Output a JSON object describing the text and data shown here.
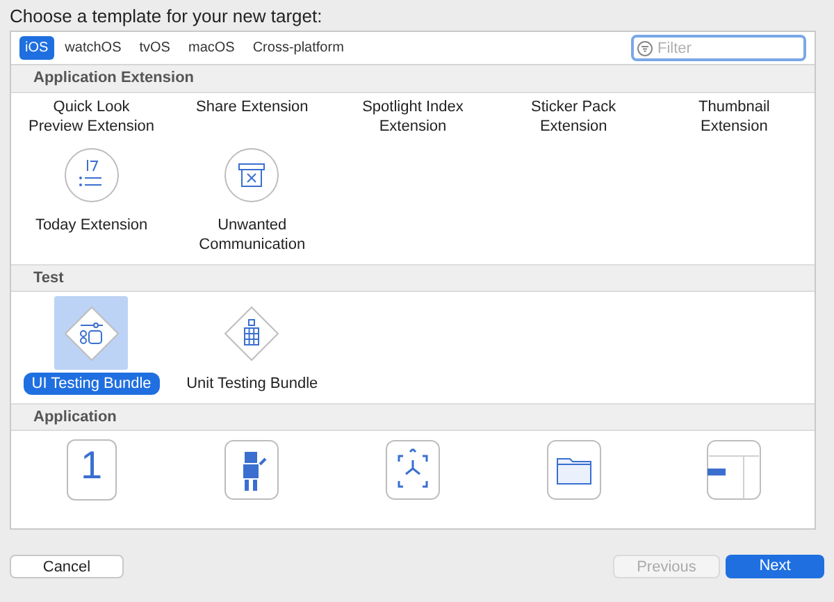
{
  "prompt": "Choose a template for your new target:",
  "tabs": [
    {
      "label": "iOS",
      "selected": true
    },
    {
      "label": "watchOS",
      "selected": false
    },
    {
      "label": "tvOS",
      "selected": false
    },
    {
      "label": "macOS",
      "selected": false
    },
    {
      "label": "Cross-platform",
      "selected": false
    }
  ],
  "filter": {
    "placeholder": "Filter"
  },
  "sections": [
    {
      "title": "Application Extension",
      "items": [
        {
          "label": "Quick Look Preview Extension",
          "selected": false
        },
        {
          "label": "Share Extension",
          "selected": false
        },
        {
          "label": "Spotlight Index Extension",
          "selected": false
        },
        {
          "label": "Sticker Pack Extension",
          "selected": false
        },
        {
          "label": "Thumbnail Extension",
          "selected": false
        },
        {
          "kind": "today",
          "label": "Today Extension",
          "selected": false
        },
        {
          "kind": "unwanted",
          "label": "Unwanted Communication",
          "selected": false
        }
      ]
    },
    {
      "title": "Test",
      "items": [
        {
          "kind": "ui-test",
          "label": "UI Testing Bundle",
          "selected": true
        },
        {
          "kind": "unit-test",
          "label": "Unit Testing Bundle",
          "selected": false
        }
      ]
    },
    {
      "title": "Application",
      "items": [
        {
          "kind": "glyph",
          "glyph": "1",
          "selected": false
        },
        {
          "kind": "game",
          "selected": false
        },
        {
          "kind": "ar",
          "selected": false
        },
        {
          "kind": "document",
          "selected": false
        },
        {
          "kind": "tabbed",
          "selected": false
        }
      ]
    }
  ],
  "buttons": [
    {
      "label": "Cancel",
      "kind": "normal"
    },
    {
      "label": "Previous",
      "kind": "disabled"
    },
    {
      "label": "Next",
      "kind": "primary"
    }
  ]
}
